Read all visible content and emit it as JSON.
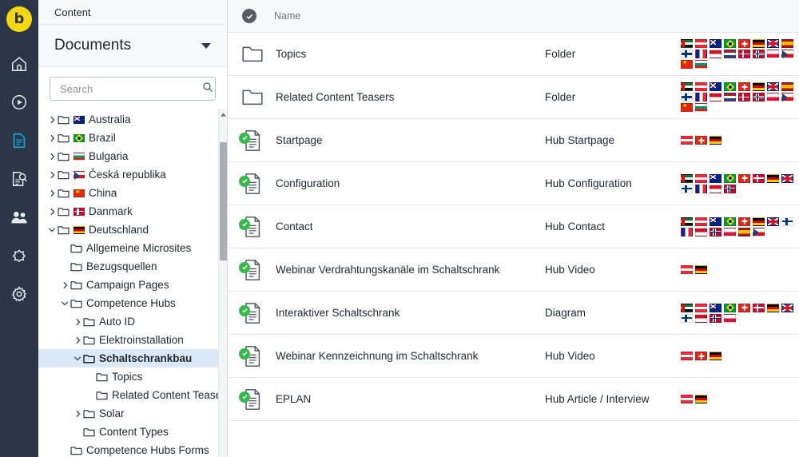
{
  "app": {
    "logo_letter": "b",
    "header_title": "Content"
  },
  "rail": {
    "items": [
      {
        "name": "home-icon",
        "label": "Home"
      },
      {
        "name": "media-icon",
        "label": "Media"
      },
      {
        "name": "content-icon",
        "label": "Content",
        "active": true
      },
      {
        "name": "search-document-icon",
        "label": "Search"
      },
      {
        "name": "users-icon",
        "label": "Users"
      },
      {
        "name": "extensions-icon",
        "label": "Extensions"
      },
      {
        "name": "settings-gear-icon",
        "label": "Settings"
      }
    ]
  },
  "tree_panel": {
    "title": "Documents",
    "search": {
      "value": "",
      "placeholder": "Search"
    },
    "nodes": [
      {
        "label": "Australia",
        "depth": 0,
        "expander": "collapsed",
        "flag": "f-au"
      },
      {
        "label": "Brazil",
        "depth": 0,
        "expander": "collapsed",
        "flag": "f-br"
      },
      {
        "label": "Bulgaria",
        "depth": 0,
        "expander": "collapsed",
        "flag": "f-bg"
      },
      {
        "label": "Česká republika",
        "depth": 0,
        "expander": "collapsed",
        "flag": "f-cz"
      },
      {
        "label": "China",
        "depth": 0,
        "expander": "collapsed",
        "flag": "f-cn"
      },
      {
        "label": "Danmark",
        "depth": 0,
        "expander": "collapsed",
        "flag": "f-dk"
      },
      {
        "label": "Deutschland",
        "depth": 0,
        "expander": "expanded",
        "flag": "f-de"
      },
      {
        "label": "Allgemeine Microsites",
        "depth": 1,
        "expander": "none"
      },
      {
        "label": "Bezugsquellen",
        "depth": 1,
        "expander": "none"
      },
      {
        "label": "Campaign Pages",
        "depth": 1,
        "expander": "collapsed"
      },
      {
        "label": "Competence Hubs",
        "depth": 1,
        "expander": "expanded"
      },
      {
        "label": "Auto ID",
        "depth": 2,
        "expander": "collapsed"
      },
      {
        "label": "Elektroinstallation",
        "depth": 2,
        "expander": "collapsed"
      },
      {
        "label": "Schaltschrankbau",
        "depth": 2,
        "expander": "expanded",
        "selected": true
      },
      {
        "label": "Topics",
        "depth": 3,
        "expander": "none"
      },
      {
        "label": "Related Content Teasers",
        "depth": 3,
        "expander": "none"
      },
      {
        "label": "Solar",
        "depth": 2,
        "expander": "collapsed"
      },
      {
        "label": "Content Types",
        "depth": 2,
        "expander": "none"
      },
      {
        "label": "Competence Hubs Forms",
        "depth": 1,
        "expander": "none"
      }
    ]
  },
  "table": {
    "columns": {
      "select": "select-all",
      "name": "Name"
    },
    "rows": [
      {
        "icon": "folder",
        "name": "Topics",
        "type": "Folder",
        "flags": [
          "f-ae",
          "f-at",
          "f-au",
          "f-br",
          "f-ch",
          "f-de",
          "f-gb",
          "f-es",
          "f-fi",
          "f-fr",
          "f-id",
          "f-nl",
          "f-dk",
          "f-no",
          "f-pl",
          "f-cz",
          "f-cn",
          "f-bg"
        ]
      },
      {
        "icon": "folder",
        "name": "Related Content Teasers",
        "type": "Folder",
        "flags": [
          "f-ae",
          "f-at",
          "f-au",
          "f-br",
          "f-ch",
          "f-de",
          "f-gb",
          "f-es",
          "f-fi",
          "f-fr",
          "f-id",
          "f-nl",
          "f-dk",
          "f-no",
          "f-pl",
          "f-cz",
          "f-cn",
          "f-bg"
        ]
      },
      {
        "icon": "document-approved",
        "name": "Startpage",
        "type": "Hub Startpage",
        "flags": [
          "f-at",
          "f-ch",
          "f-de"
        ]
      },
      {
        "icon": "document-approved",
        "name": "Configuration",
        "type": "Hub Configuration",
        "flags": [
          "f-ae",
          "f-at",
          "f-au",
          "f-br",
          "f-ch",
          "f-dk",
          "f-de",
          "f-gb",
          "f-fi",
          "f-fr",
          "f-id",
          "f-no"
        ]
      },
      {
        "icon": "document-approved",
        "name": "Contact",
        "type": "Hub Contact",
        "flags": [
          "f-ae",
          "f-at",
          "f-au",
          "f-br",
          "f-ch",
          "f-de",
          "f-gb",
          "f-fi",
          "f-fr",
          "f-id",
          "f-no",
          "f-pl",
          "f-es",
          "f-cz"
        ]
      },
      {
        "icon": "document-approved",
        "name": "Webinar Verdrahtungskanäle im Schaltschrank",
        "type": "Hub Video",
        "flags": [
          "f-at",
          "f-de"
        ]
      },
      {
        "icon": "document-approved",
        "name": "Interaktiver Schaltschrank",
        "type": "Diagram",
        "flags": [
          "f-ae",
          "f-at",
          "f-au",
          "f-br",
          "f-ch",
          "f-dk",
          "f-de",
          "f-gb",
          "f-fi",
          "f-id",
          "f-no",
          "f-pl"
        ]
      },
      {
        "icon": "document-approved",
        "name": "Webinar Kennzeichnung im Schaltschrank",
        "type": "Hub Video",
        "flags": [
          "f-at",
          "f-ch",
          "f-de"
        ]
      },
      {
        "icon": "document-approved",
        "name": "EPLAN",
        "type": "Hub Article / Interview",
        "flags": [
          "f-at",
          "f-de"
        ]
      }
    ]
  },
  "colors": {
    "rail_bg": "#2b3648",
    "logo_bg": "#f6d714",
    "accent_blue": "#1b9fd4",
    "selection_blue": "#dbe9f6",
    "approved_green": "#36b84a"
  }
}
